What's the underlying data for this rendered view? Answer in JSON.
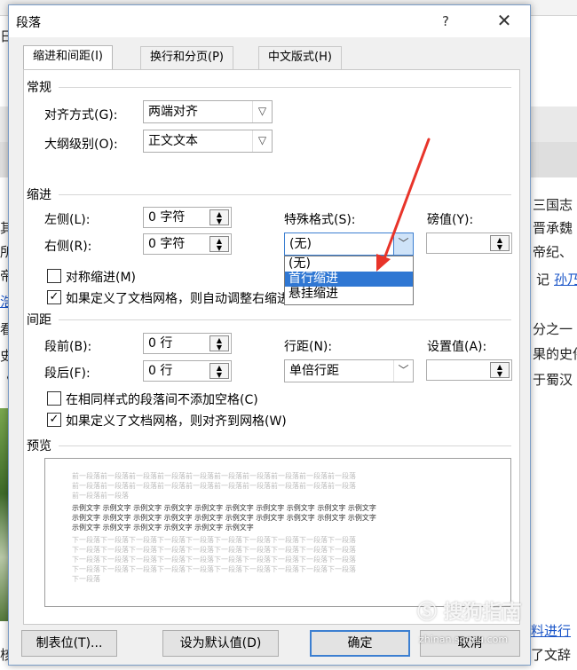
{
  "background": {
    "left_chars": [
      "日",
      "其",
      "所",
      "帝",
      "浩",
      "看",
      "史",
      "《",
      "核"
    ],
    "right_texts": [
      "三国志",
      "晋承魏",
      "帝纪、",
      "记",
      "孙乃",
      "分之一",
      "果的史件",
      "于蜀汉",
      "料进行",
      "了文辞"
    ]
  },
  "dialog": {
    "title": "段落",
    "help": "?",
    "close": "✕",
    "tabs": [
      "缩进和间距(I)",
      "换行和分页(P)",
      "中文版式(H)"
    ],
    "general": {
      "header": "常规",
      "alignment_label": "对齐方式(G):",
      "alignment_value": "两端对齐",
      "outline_label": "大纲级别(O):",
      "outline_value": "正文文本"
    },
    "indent": {
      "header": "缩进",
      "left_label": "左侧(L):",
      "left_value": "0 字符",
      "right_label": "右侧(R):",
      "right_value": "0 字符",
      "special_label": "特殊格式(S):",
      "special_value": "(无)",
      "by_label": "磅值(Y):",
      "by_value": "",
      "mirror_label": "对称缩进(M)",
      "grid_label": "如果定义了文档网格，则自动调整右缩进(D)",
      "dropdown_options": [
        "(无)",
        "首行缩进",
        "悬挂缩进"
      ],
      "dropdown_selected": "首行缩进"
    },
    "spacing": {
      "header": "间距",
      "before_label": "段前(B):",
      "before_value": "0 行",
      "after_label": "段后(F):",
      "after_value": "0 行",
      "line_label": "行距(N):",
      "line_value": "单倍行距",
      "at_label": "设置值(A):",
      "at_value": "",
      "no_space_label": "在相同样式的段落间不添加空格(C)",
      "snap_label": "如果定义了文档网格，则对齐到网格(W)"
    },
    "preview": {
      "header": "预览",
      "prev_text": "前一段落前一段落前一段落前一段落前一段落前一段落前一段落前一段落前一段落前一段落",
      "prev_text_short": "前一段落前一段落",
      "sample_text": "示例文字 示例文字 示例文字 示例文字 示例文字 示例文字 示例文字 示例文字 示例文字 示例文字",
      "sample_text_short": "示例文字 示例文字 示例文字 示例文字 示例文字 示例文字",
      "next_text": "下一段落下一段落下一段落下一段落下一段落下一段落下一段落下一段落下一段落下一段落",
      "next_text_short": "下一段落"
    },
    "buttons": {
      "tabs_label": "制表位(T)...",
      "default_label": "设为默认值(D)",
      "ok_label": "确定",
      "cancel_label": "取消"
    }
  },
  "watermark": {
    "text": "搜狗指南",
    "url": "zhinan.sogou.com"
  },
  "colors": {
    "accent": "#3c7fd1",
    "selection": "#2f77d3",
    "arrow": "#e8342a"
  }
}
